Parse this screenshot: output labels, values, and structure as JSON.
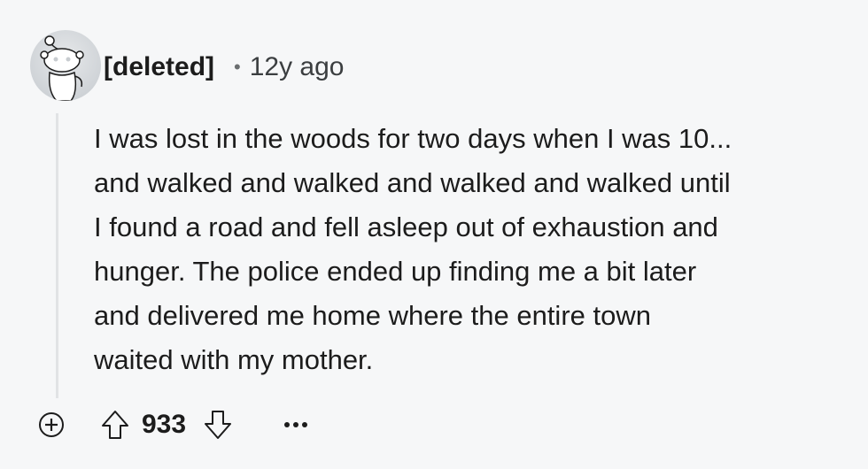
{
  "comment": {
    "author": "[deleted]",
    "separator": "•",
    "time": "12y ago",
    "body_lines": [
      "I was lost in the woods for two days when I was 10...",
      "and walked and walked and walked and walked until",
      "I found a road and fell asleep out of exhaustion and",
      "hunger. The police ended up finding me a bit later",
      "and delivered me home where the entire town",
      "waited with my mother."
    ],
    "score": "933"
  },
  "icons": {
    "avatar": "reddit-snoo-avatar",
    "expand": "plus-circle-icon",
    "upvote": "arrow-up-icon",
    "downvote": "arrow-down-icon",
    "more": "ellipsis-icon"
  },
  "colors": {
    "background": "#f6f7f8",
    "text": "#1c1c1c",
    "muted": "#6b6e70",
    "thread_line": "#e1e3e5"
  }
}
